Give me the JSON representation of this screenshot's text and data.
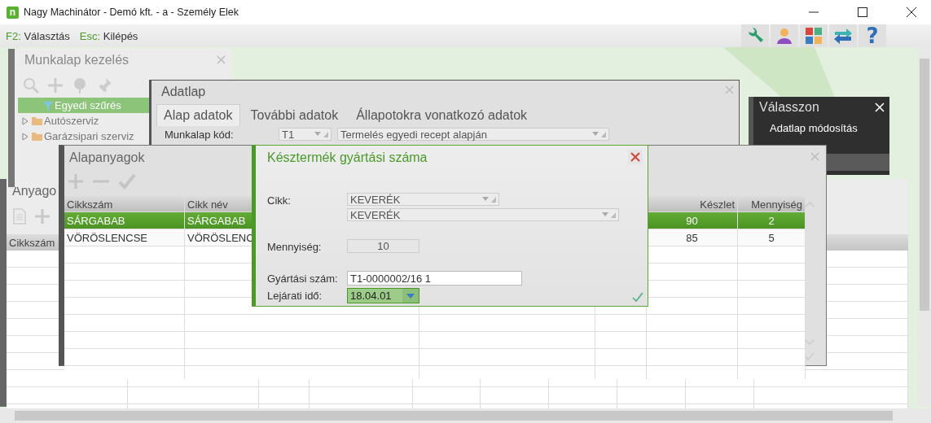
{
  "window": {
    "logo": "n",
    "title": "Nagy Machinátor - Demó kft. - a - Személy Elek"
  },
  "shortcuts": [
    {
      "key": "F2:",
      "label": "Választás"
    },
    {
      "key": "Esc:",
      "label": "Kilépés"
    }
  ],
  "help_glyph": "?",
  "munkalap_panel": {
    "title": "Munkalap kezelés",
    "tree": [
      {
        "label": "Egyedi szűrés",
        "kind": "filter",
        "selected": true
      },
      {
        "label": "Autószerviz",
        "kind": "folder",
        "selected": false,
        "expanded": false
      },
      {
        "label": "Garázsipari szerviz",
        "kind": "folder",
        "selected": false,
        "expanded": false
      }
    ]
  },
  "anyagok_panel": {
    "title": "Anyago",
    "columns": [
      "Cikkszám"
    ]
  },
  "adatlap": {
    "title": "Adatlap",
    "tabs": [
      {
        "label": "Alap adatok",
        "selected": true
      },
      {
        "label": "További adatok",
        "selected": false
      },
      {
        "label": "Állapotokra vonatkozó adatok",
        "selected": false
      }
    ],
    "fields": [
      {
        "label": "Munkalap kód:",
        "code": "T1",
        "value": "Termelés egyedi recept alapján"
      }
    ]
  },
  "valasszon": {
    "title": "Válasszon",
    "items": [
      {
        "label": "Adatlap módosítás"
      }
    ]
  },
  "alapanyagok": {
    "title": "Alapanyagok",
    "columns": [
      "Cikkszám",
      "Cikk név",
      "Készlet",
      "Mennyiség"
    ],
    "rows": [
      {
        "cells": [
          "SÁRGABAB",
          "SÁRGABAB",
          "90",
          "2"
        ],
        "selected": true
      },
      {
        "cells": [
          "VÖRÖSLENCSE",
          "VÖRÖSLENC",
          "85",
          "5"
        ],
        "selected": false
      }
    ]
  },
  "dialog": {
    "title": "Késztermék gyártási száma",
    "fields": [
      {
        "label": "Cikk:",
        "kind": "combo",
        "values": [
          "KEVERÉK",
          "KEVERÉK"
        ]
      },
      {
        "label": "Mennyiség:",
        "kind": "number",
        "value": "10"
      },
      {
        "label": "Gyártási szám:",
        "kind": "text",
        "value": "T1-0000002/16 1"
      },
      {
        "label": "Lejárati idő:",
        "kind": "date",
        "value": "18.04.01"
      }
    ]
  }
}
